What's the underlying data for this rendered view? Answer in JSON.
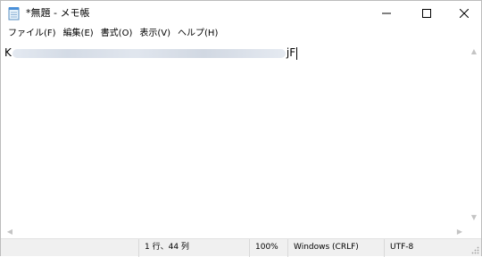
{
  "window": {
    "title": "*無題 - メモ帳",
    "icon": "notepad-icon"
  },
  "menu": {
    "items": [
      "ファイル(F)",
      "編集(E)",
      "書式(O)",
      "表示(V)",
      "ヘルプ(H)"
    ]
  },
  "editor": {
    "text_start": "K",
    "text_end": "jF"
  },
  "status": {
    "position": "1 行、44 列",
    "zoom": "100%",
    "line_ending": "Windows (CRLF)",
    "encoding": "UTF-8"
  }
}
